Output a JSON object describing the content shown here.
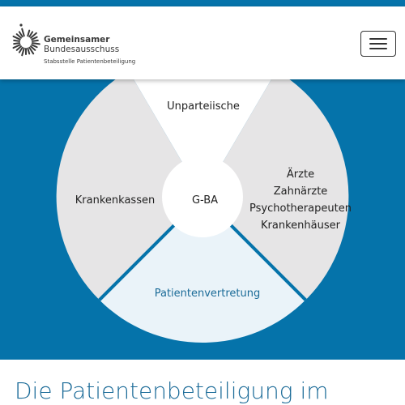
{
  "header": {
    "logo_title": "Gemeinsamer",
    "logo_subtitle": "Bundesausschuss",
    "logo_tagline": "Stabsstelle Patientenbeteiligung",
    "menu_icon": "hamburger-icon"
  },
  "diagram": {
    "center": "G-BA",
    "segments": {
      "top": "Unparteiische",
      "left": "Krankenkassen",
      "right": [
        "Ärzte",
        "Zahnärzte",
        "Psychotherapeuten",
        "Krankenhäuser"
      ],
      "bottom": "Patientenvertretung"
    }
  },
  "main": {
    "heading": "Die Patientenbeteiligung im"
  },
  "colors": {
    "brand_blue": "#0573aa",
    "segment_gray": "#e6e5e6",
    "patient_segment": "#eaf3f9",
    "center": "#ffffff",
    "heading_text": "#1b6b98"
  }
}
